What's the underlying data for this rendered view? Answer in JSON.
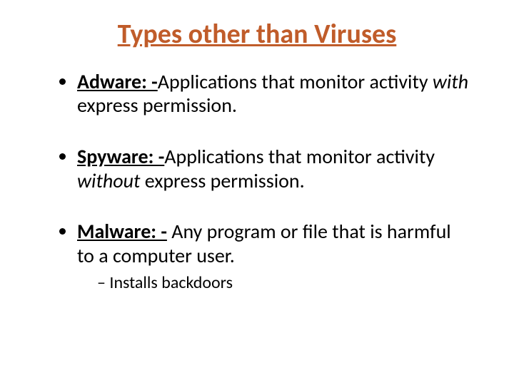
{
  "title": "Types other than Viruses",
  "items": [
    {
      "term": "Adware: -",
      "text_a": "Applications that monitor activity ",
      "em": "with",
      "text_b": " express permission."
    },
    {
      "term": "Spyware: -",
      "text_a": "Applications that monitor activity ",
      "em": "without",
      "text_b": " express permission."
    },
    {
      "term": "Malware: -",
      "text_a": " Any program or file that is harmful to a computer user.",
      "em": "",
      "text_b": "",
      "sub": [
        "Installs backdoors"
      ]
    }
  ]
}
